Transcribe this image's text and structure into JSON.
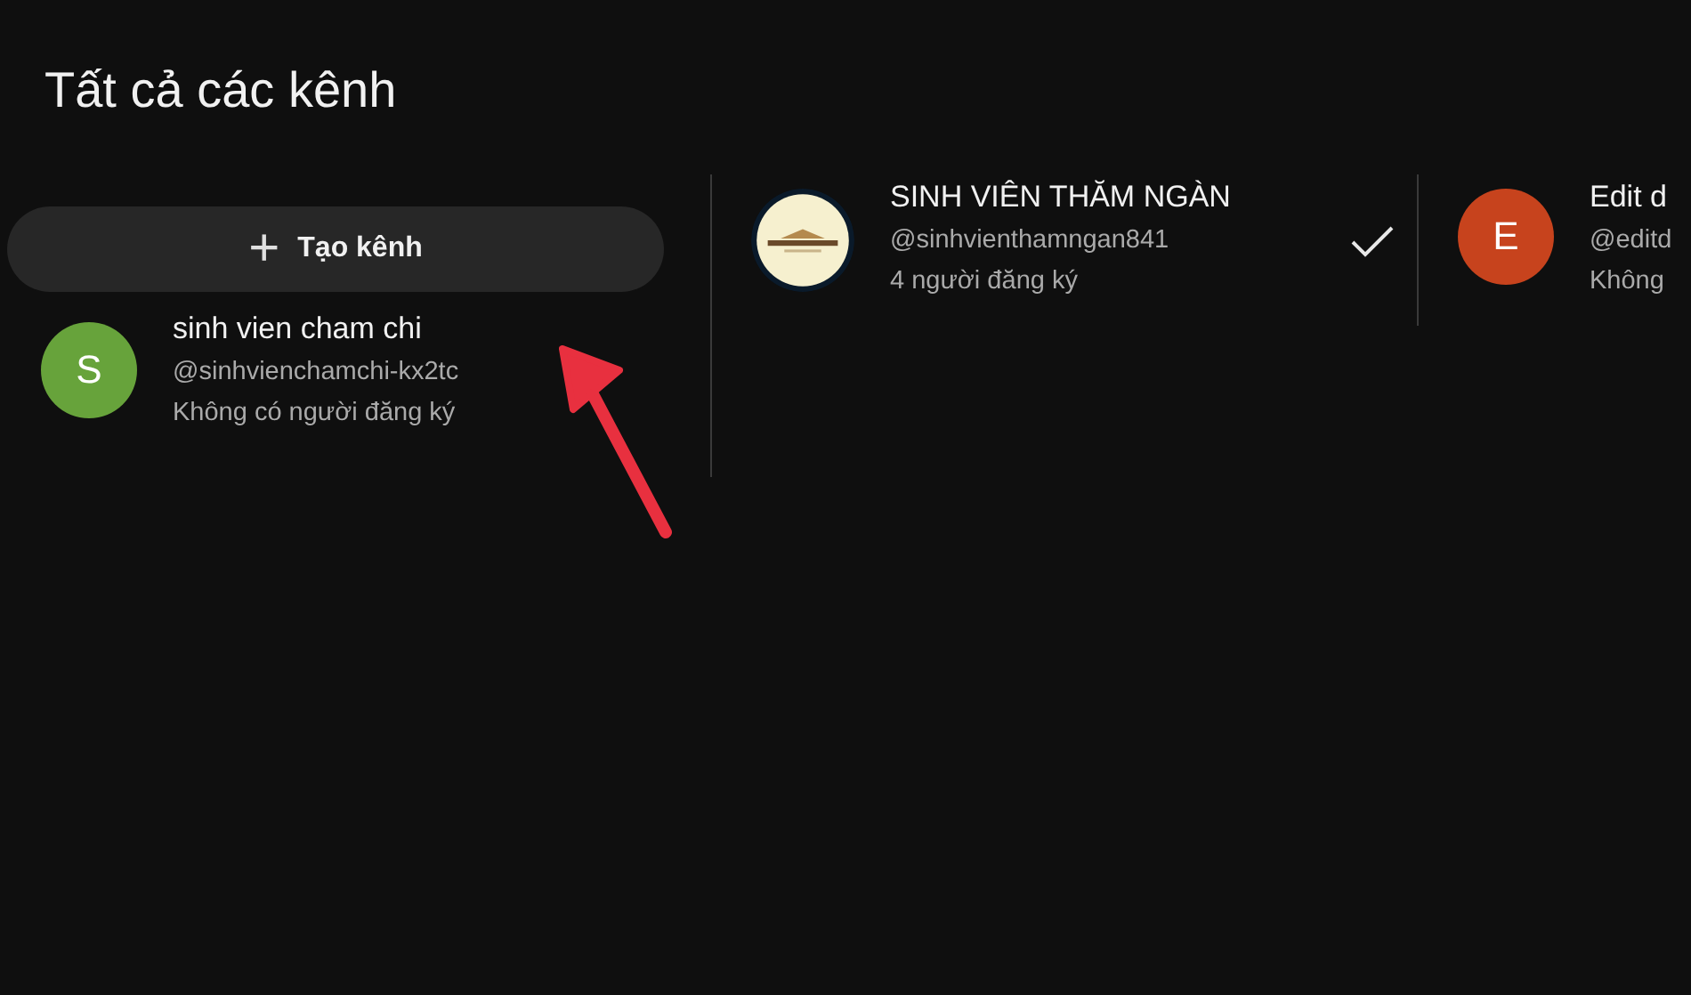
{
  "title": "Tất cả các kênh",
  "create_button": {
    "label": "Tạo kênh",
    "icon": "+"
  },
  "channels": [
    {
      "name": "sinh vien cham chi",
      "handle": "@sinhvienchamchi-kx2tc",
      "subscribers": "Không có người đăng ký",
      "avatar": {
        "kind": "letter",
        "letter": "S",
        "color": "#67a33b"
      },
      "selected": false
    },
    {
      "name": "SINH VIÊN THĂM NGÀN",
      "handle": "@sinhvienthamngan841",
      "subscribers": "4 người đăng ký",
      "selected": true
    },
    {
      "name": "Edit d",
      "handle": "@editd",
      "subscribers": "Không",
      "avatar": {
        "kind": "letter",
        "letter": "E",
        "color": "#c7431d"
      }
    }
  ]
}
